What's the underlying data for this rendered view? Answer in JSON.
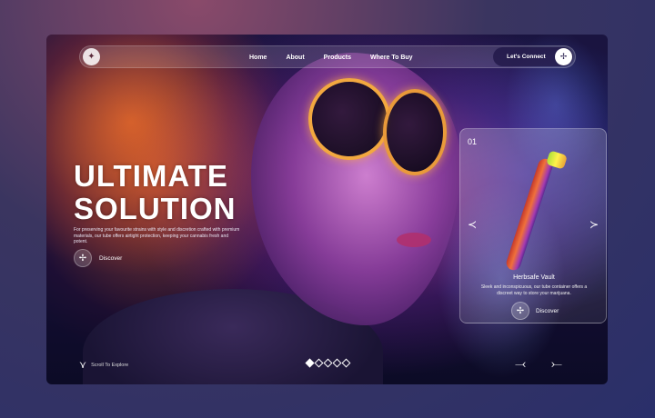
{
  "nav": {
    "logo_icon": "leaf-emblem-icon",
    "items": [
      {
        "label": "Home"
      },
      {
        "label": "About"
      },
      {
        "label": "Products"
      },
      {
        "label": "Where To Buy"
      }
    ],
    "connect_label": "Let's Connect",
    "connect_icon": "tri-blade-icon"
  },
  "hero": {
    "title_line1": "ULTIMATE",
    "title_line2": "SOLUTION",
    "description": "For preserving your favourite strains with style and discretion crafted with premium materials, our tube offers airtight protection, keeping your cannabis fresh and potent.",
    "discover_label": "Discover",
    "discover_icon": "tri-blade-icon"
  },
  "scroll": {
    "label": "Scroll To Explore",
    "icon": "tri-blade-icon"
  },
  "slider": {
    "total": 5,
    "active": 1
  },
  "card": {
    "number": "01",
    "product_name": "Herbsafe Vault",
    "product_desc": "Sleek and inconspicuous, our tube container offers a discreet way to store your marijuana.",
    "discover_label": "Discover",
    "prev_icon": "arrow-left-icon",
    "next_icon": "arrow-right-icon",
    "tube_colors": [
      "#f0703a",
      "#a43ab0"
    ],
    "cap_colors": [
      "#aee03a",
      "#fff14a"
    ]
  },
  "nav_arrows": {
    "prev_icon": "arrow-left-icon",
    "next_icon": "arrow-right-icon"
  }
}
